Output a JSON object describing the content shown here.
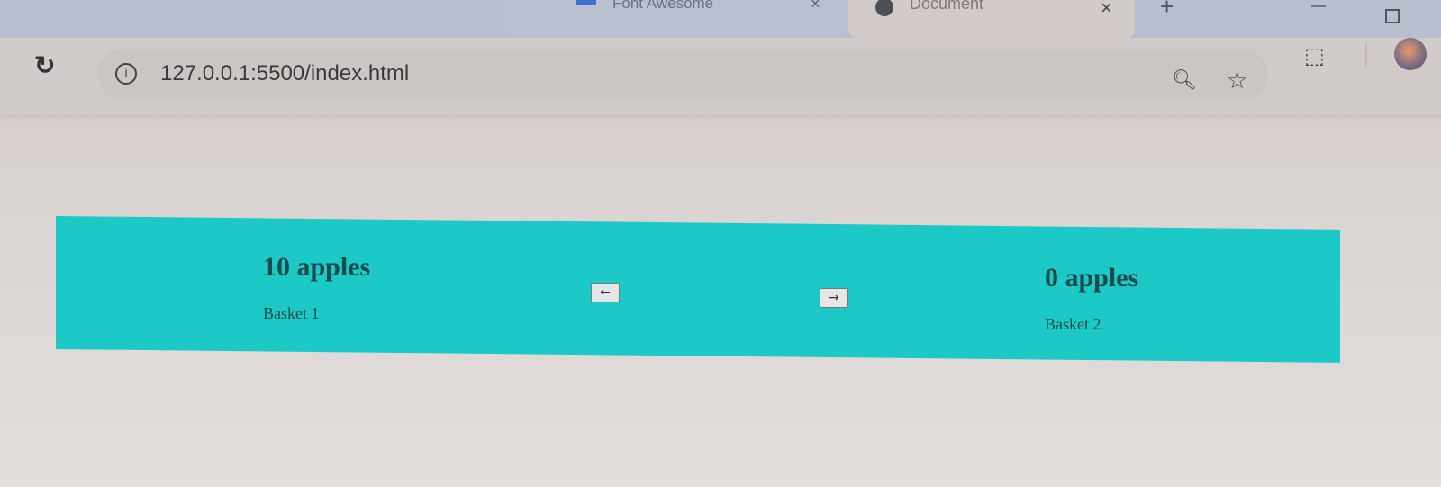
{
  "browser": {
    "tabs": [
      {
        "title": "Font Awesome",
        "close_icon": "×",
        "active": false
      },
      {
        "title": "Document",
        "close_icon": "×",
        "active": true
      }
    ],
    "new_tab_icon": "+",
    "address": "127.0.0.1:5500/index.html",
    "icons": {
      "reload": "reload-icon",
      "info": "info-icon",
      "zoom": "zoom-icon",
      "bookmark": "star-icon",
      "extensions": "puzzle-icon",
      "profile": "avatar"
    }
  },
  "page": {
    "background_color": "#1cc9c6",
    "basket1": {
      "count": "10 apples",
      "label": "Basket 1"
    },
    "basket2": {
      "count": "0 apples",
      "label": "Basket 2"
    },
    "move_left_label": "←",
    "move_right_label": "→"
  }
}
